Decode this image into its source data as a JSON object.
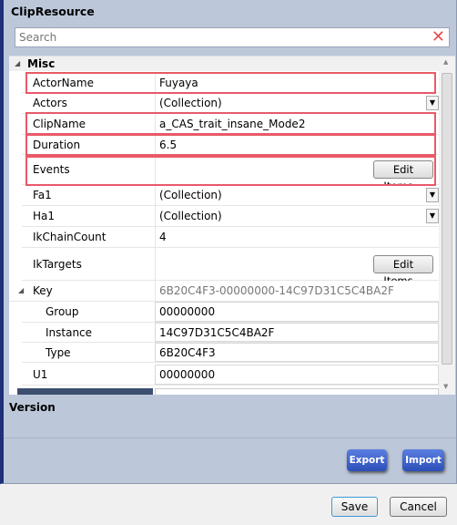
{
  "panel": {
    "title": "ClipResource"
  },
  "search": {
    "placeholder": "Search"
  },
  "grid": {
    "category": "Misc",
    "rows": [
      {
        "label": "ActorName",
        "value": "Fuyaya"
      },
      {
        "label": "Actors",
        "value": "(Collection)"
      },
      {
        "label": "ClipName",
        "value": "a_CAS_trait_insane_Mode2"
      },
      {
        "label": "Duration",
        "value": "6.5"
      },
      {
        "label": "Events",
        "value": "",
        "button": "Edit Items..."
      },
      {
        "label": "Fa1",
        "value": "(Collection)"
      },
      {
        "label": "Ha1",
        "value": "(Collection)"
      },
      {
        "label": "IkChainCount",
        "value": "4"
      },
      {
        "label": "IkTargets",
        "value": "",
        "button": "Edit Items..."
      },
      {
        "label": "Key",
        "value": "6B20C4F3-00000000-14C97D31C5C4BA2F"
      },
      {
        "label": "Group",
        "value": "00000000"
      },
      {
        "label": "Instance",
        "value": "14C97D31C5C4BA2F"
      },
      {
        "label": "Type",
        "value": "6B20C4F3"
      },
      {
        "label": "U1",
        "value": "00000000"
      }
    ]
  },
  "version": {
    "label": "Version"
  },
  "actions": {
    "export": "Export",
    "import": "Import",
    "save": "Save",
    "cancel": "Cancel"
  },
  "colors": {
    "highlight": "#e85a68",
    "accent_button": "#2b4fb8",
    "panel_bg": "#bcc8da"
  }
}
